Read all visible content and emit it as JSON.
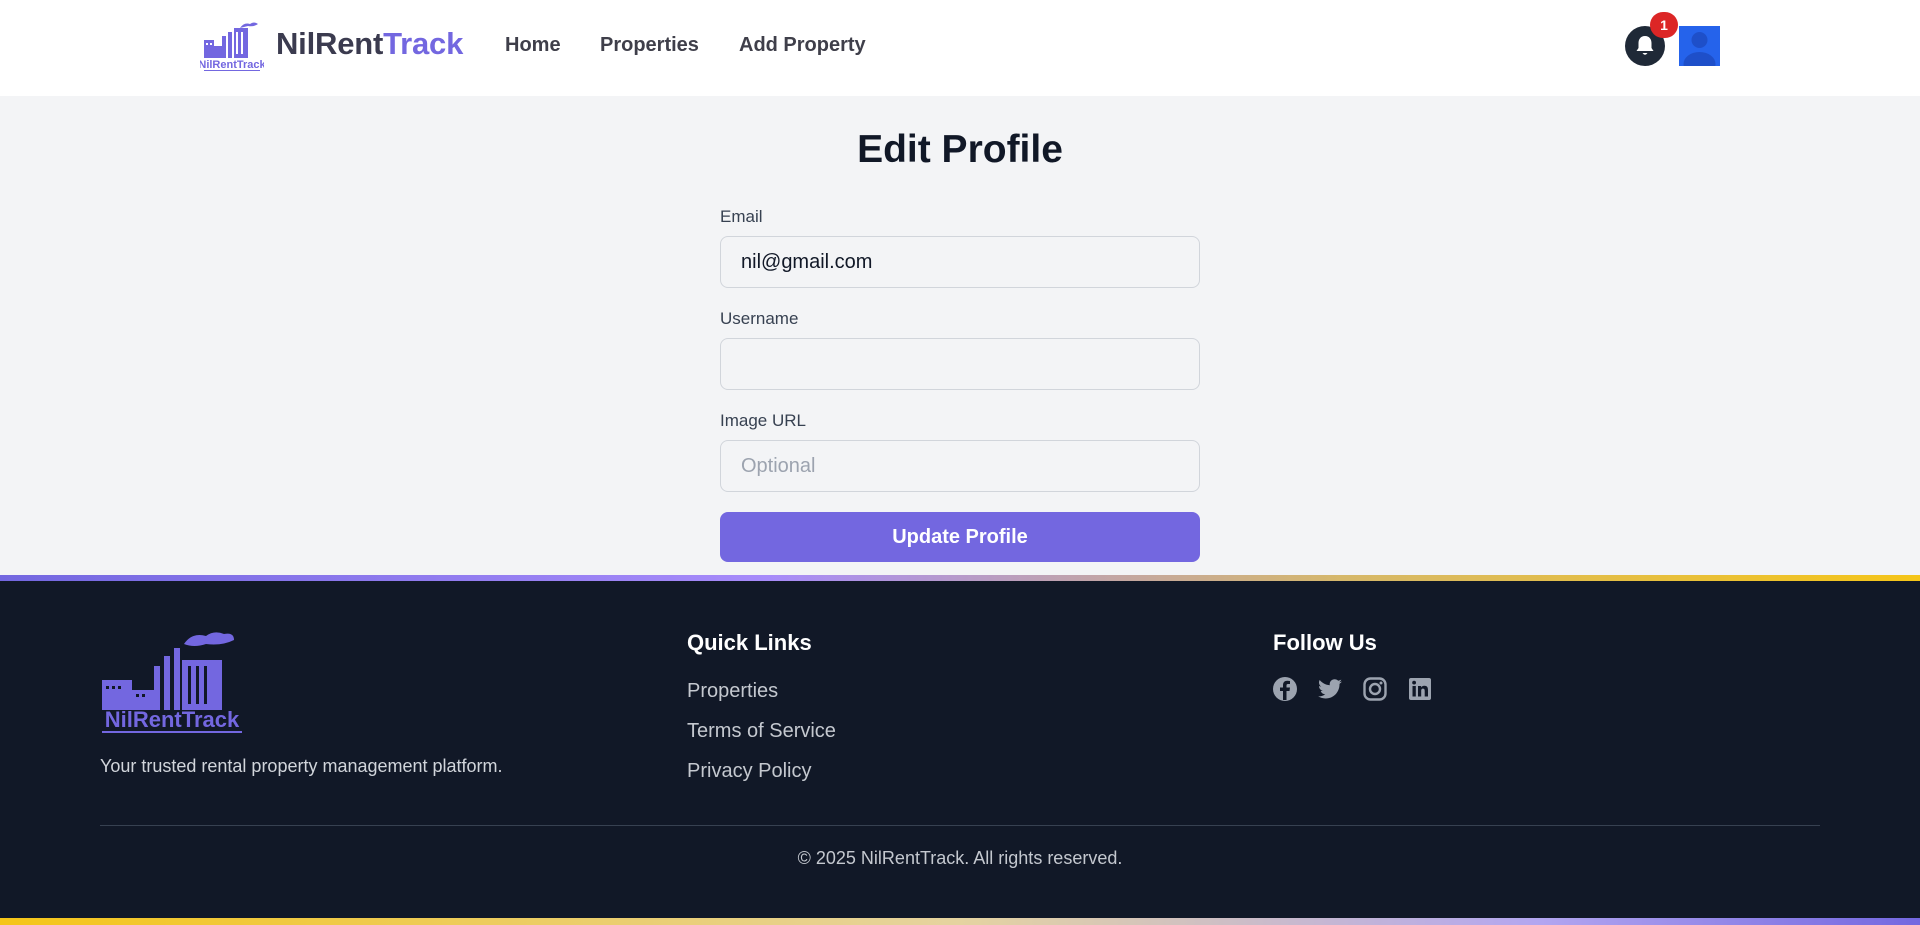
{
  "header": {
    "logo_text": "NilRentTrack",
    "brand_primary": "NilRent",
    "brand_accent": "Track",
    "nav": {
      "home": "Home",
      "properties": "Properties",
      "add_property": "Add Property"
    },
    "notification_count": "1"
  },
  "form": {
    "title": "Edit Profile",
    "email_label": "Email",
    "email_value": "nil@gmail.com",
    "username_label": "Username",
    "username_value": "",
    "image_label": "Image URL",
    "image_placeholder": "Optional",
    "submit_label": "Update Profile"
  },
  "footer": {
    "logo_text": "NilRentTrack",
    "tagline": "Your trusted rental property management platform.",
    "quick_links_heading": "Quick Links",
    "quick_links": [
      "Properties",
      "Terms of Service",
      "Privacy Policy"
    ],
    "follow_heading": "Follow Us",
    "social_icons": [
      "facebook-icon",
      "twitter-icon",
      "instagram-icon",
      "linkedin-icon"
    ],
    "copyright": "© 2025 NilRentTrack. All rights reserved."
  },
  "colors": {
    "accent": "#7367e0",
    "footer_bg": "#111827",
    "badge": "#dc2626",
    "avatar_bg": "#2563eb"
  }
}
